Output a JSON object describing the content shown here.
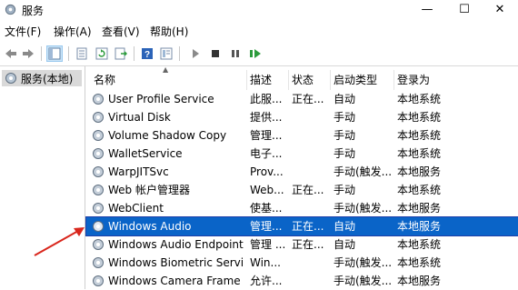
{
  "window": {
    "title": "服务",
    "minimize_glyph": "—",
    "maximize_glyph": "☐",
    "close_glyph": "✕"
  },
  "menu": [
    "文件(F)",
    "操作(A)",
    "查看(V)",
    "帮助(H)"
  ],
  "tree": {
    "label": "服务(本地)"
  },
  "columns": [
    "名称",
    "描述",
    "状态",
    "启动类型",
    "登录为"
  ],
  "services": [
    {
      "name": "User Profile Service",
      "desc": "此服...",
      "status": "正在...",
      "startup": "自动",
      "logon": "本地系统"
    },
    {
      "name": "Virtual Disk",
      "desc": "提供...",
      "status": "",
      "startup": "手动",
      "logon": "本地系统"
    },
    {
      "name": "Volume Shadow Copy",
      "desc": "管理...",
      "status": "",
      "startup": "手动",
      "logon": "本地系统"
    },
    {
      "name": "WalletService",
      "desc": "电子...",
      "status": "",
      "startup": "手动",
      "logon": "本地系统"
    },
    {
      "name": "WarpJITSvc",
      "desc": "Prov...",
      "status": "",
      "startup": "手动(触发...",
      "logon": "本地服务"
    },
    {
      "name": "Web 帐户管理器",
      "desc": "Web...",
      "status": "正在...",
      "startup": "手动",
      "logon": "本地系统"
    },
    {
      "name": "WebClient",
      "desc": "使基...",
      "status": "",
      "startup": "手动(触发...",
      "logon": "本地服务"
    },
    {
      "name": "Windows Audio",
      "desc": "管理...",
      "status": "正在...",
      "startup": "自动",
      "logon": "本地服务",
      "selected": true
    },
    {
      "name": "Windows Audio Endpoint...",
      "desc": "管理 ...",
      "status": "正在...",
      "startup": "自动",
      "logon": "本地系统"
    },
    {
      "name": "Windows Biometric Servi...",
      "desc": "Win...",
      "status": "",
      "startup": "手动(触发...",
      "logon": "本地系统"
    },
    {
      "name": "Windows Camera Frame ...",
      "desc": "允许...",
      "status": "",
      "startup": "手动(触发...",
      "logon": "本地服务"
    }
  ],
  "colors": {
    "selection": "#0a64c8",
    "annotation_arrow": "#d9261c",
    "tree_selected": "#d9d9d9"
  }
}
